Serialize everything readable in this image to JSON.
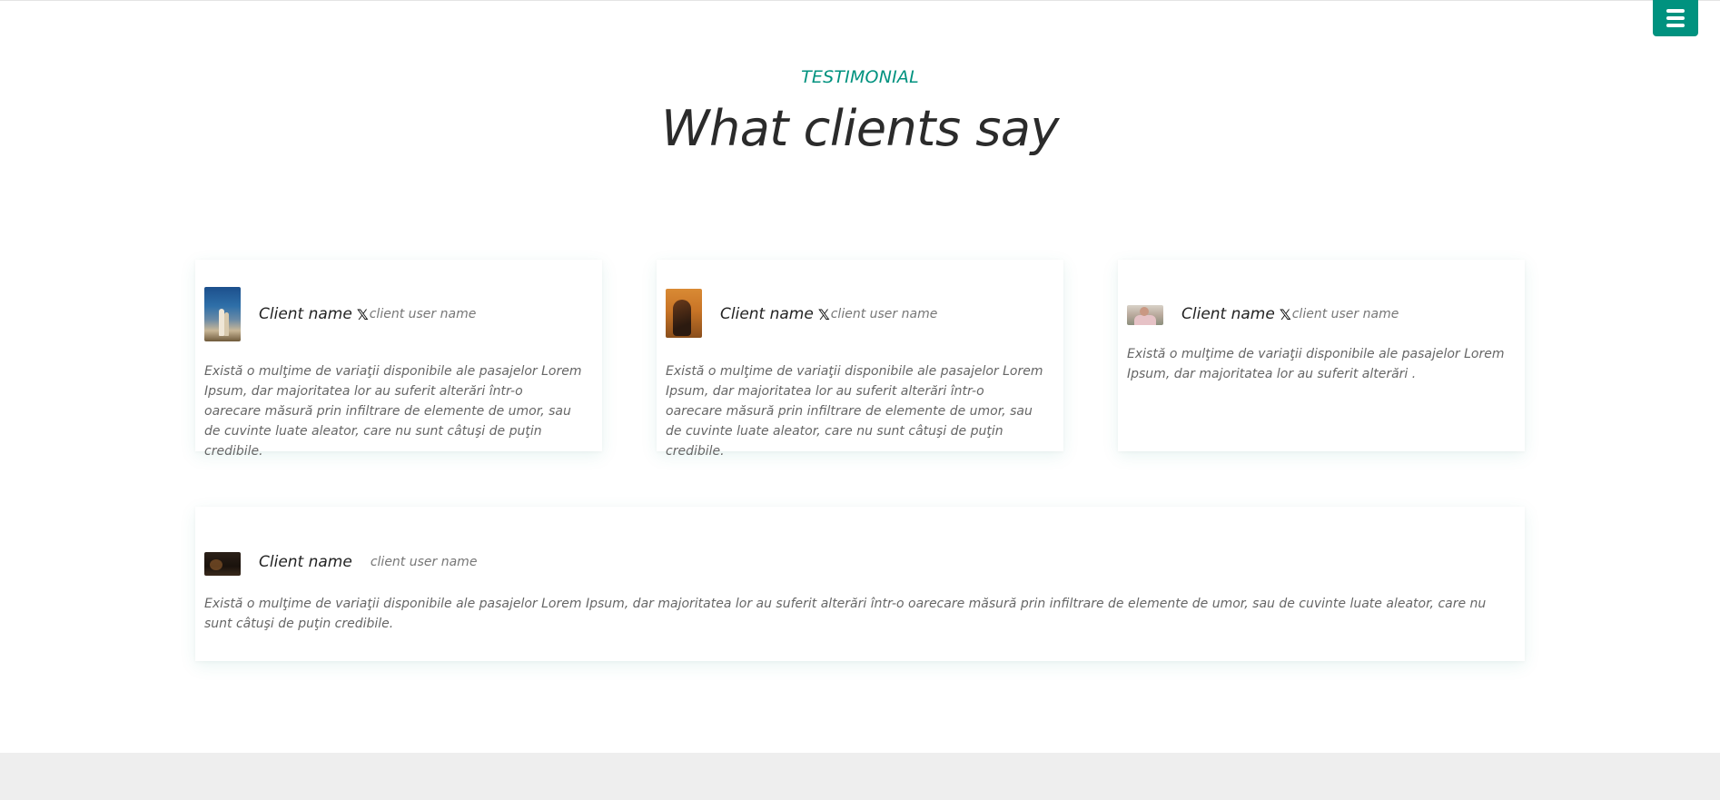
{
  "colors": {
    "accent": "#00927f",
    "title": "#2b2b2b",
    "body_text": "#666666",
    "footer_band": "#eeeeee"
  },
  "nav": {
    "menu_icon": "hamburger-menu-icon"
  },
  "section": {
    "label": "TESTIMONIAL",
    "title": "What clients say"
  },
  "testimonials": [
    {
      "avatar": "client-photo",
      "name": "Client name",
      "social_icon": "x-logo-icon",
      "social_glyph": "𝕏",
      "username": "client user name",
      "quote": "Există o mulţime de variaţii disponibile ale pasajelor Lorem Ipsum, dar majoritatea lor au suferit alterări într-o oarecare măsură prin infiltrare de elemente de umor, sau de cuvinte luate aleator, care nu sunt câtuşi de puţin credibile."
    },
    {
      "avatar": "client-photo",
      "name": "Client name",
      "social_icon": "x-logo-icon",
      "social_glyph": "𝕏",
      "username": "client user name",
      "quote": "Există o mulţime de variaţii disponibile ale pasajelor Lorem Ipsum, dar majoritatea lor au suferit alterări într-o oarecare măsură prin infiltrare de elemente de umor, sau de cuvinte luate aleator, care nu sunt câtuşi de puţin credibile."
    },
    {
      "avatar": "client-photo",
      "name": "Client name",
      "social_icon": "x-logo-icon",
      "social_glyph": "𝕏",
      "username": "client user name",
      "quote": "Există o mulţime de variaţii disponibile ale pasajelor Lorem Ipsum, dar majoritatea lor au suferit alterări ."
    },
    {
      "avatar": "client-photo",
      "name": "Client name",
      "username": "client user name",
      "quote": "Există o mulţime de variaţii disponibile ale pasajelor Lorem Ipsum, dar majoritatea lor au suferit alterări într-o oarecare măsură prin infiltrare de elemente de umor, sau de cuvinte luate aleator, care nu sunt câtuşi de puţin credibile."
    }
  ]
}
